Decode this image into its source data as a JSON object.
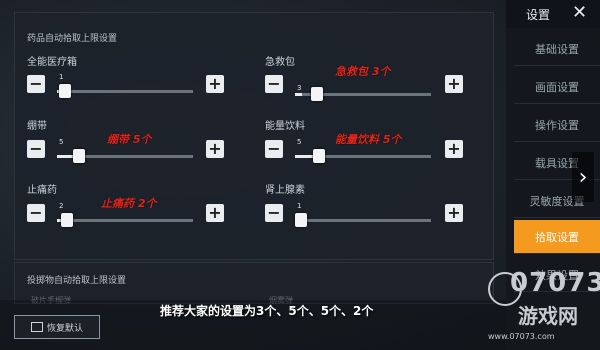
{
  "panel": {
    "title": "药品自动拾取上限设置"
  },
  "items": [
    {
      "label": "全能医疗箱",
      "value": "1",
      "level": 0.05,
      "note": ""
    },
    {
      "label": "急救包",
      "value": "3",
      "level": 0.05,
      "note": "急救包 3个"
    },
    {
      "label": "绷带",
      "value": "5",
      "level": 0.1,
      "note": "绷带 5个"
    },
    {
      "label": "能量饮料",
      "value": "5",
      "level": 0.1,
      "note": "能量饮料 5个"
    },
    {
      "label": "止痛药",
      "value": "2",
      "level": 0.1,
      "note": "止痛药 2个"
    },
    {
      "label": "肾上腺素",
      "value": "1",
      "level": 0.03,
      "note": ""
    }
  ],
  "section2": {
    "title": "投掷物自动拾取上限设置",
    "ghost_left": "破片手榴弹",
    "ghost_right": "烟雾弹"
  },
  "buttons": {
    "minus": "−",
    "plus": "+"
  },
  "sidebar": {
    "title": "设置",
    "close": "✕",
    "items": [
      "基础设置",
      "画面设置",
      "操作设置",
      "载具设置",
      "灵敏度设置",
      "拾取设置",
      "效果设置"
    ],
    "active_index": 5
  },
  "caption": "推荐大家的设置为3个、5个、5个、2个",
  "reset_label": "恢复默认",
  "watermark": {
    "num": "07073",
    "cn": "游戏网",
    "url": "www.07073.com"
  },
  "colors": {
    "accent": "#f39a1f",
    "annotation": "#e0251c"
  }
}
